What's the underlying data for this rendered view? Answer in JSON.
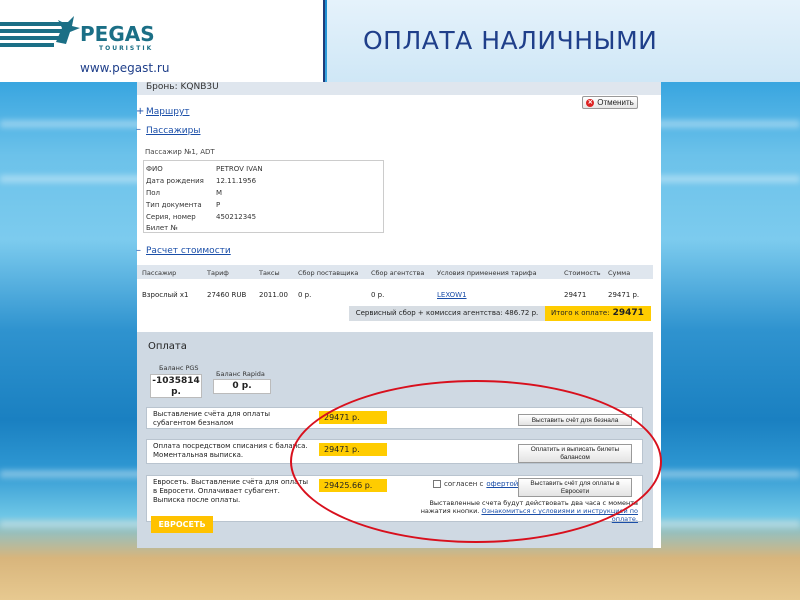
{
  "header": {
    "brand": "PEGAS",
    "brand_sub": "TOURISTIK",
    "url": "www.pegast.ru",
    "slide_title": "ОПЛАТА НАЛИЧНЫМИ"
  },
  "booking": {
    "label": "Бронь: KQNB3U",
    "cancel_label": "Отменить"
  },
  "sections": {
    "route": "Маршрут",
    "route_prefix": "+",
    "passengers": "Пассажиры",
    "passengers_prefix": "–",
    "pricing": "Расчет стоимости",
    "pricing_prefix": "–"
  },
  "passenger": {
    "title": "Пассажир №1, ADT",
    "rows": [
      {
        "label": "ФИО",
        "value": "PETROV IVAN"
      },
      {
        "label": "Дата рождения",
        "value": "12.11.1956"
      },
      {
        "label": "Пол",
        "value": "M"
      },
      {
        "label": "Тип документа",
        "value": "P"
      },
      {
        "label": "Серия, номер",
        "value": "450212345"
      },
      {
        "label": "Билет №",
        "value": ""
      }
    ]
  },
  "pricing_table": {
    "headers": [
      "Пассажир",
      "Тариф",
      "Таксы",
      "Сбор поставщика",
      "Сбор агентства",
      "Условия применения тарифа",
      "Стоимость",
      "Сумма"
    ],
    "row": [
      "Взрослый x1",
      "27460 RUB",
      "2011.00",
      "0 р.",
      "0 р.",
      "LEXOW1",
      "29471",
      "29471 р."
    ],
    "service_fee": "Сервисный сбор + комиссия агентства: 486.72 р.",
    "total_label": "Итого к оплате:",
    "total_value": "29471"
  },
  "payment": {
    "title": "Оплата",
    "balance_pgs_label": "Баланс PGS",
    "balance_pgs_value": "-1035814 р.",
    "balance_rapida_label": "Баланс Rapida",
    "balance_rapida_value": "0 р.",
    "options": [
      {
        "text": "Выставление счёта для оплаты субагентом безналом",
        "amount": "29471 р.",
        "button": "Выставить счёт для безнала"
      },
      {
        "text": "Оплата посредством списания с баланса. Моментальная выписка.",
        "amount": "29471 р.",
        "button": "Оплатить и выписать билеты балансом"
      },
      {
        "text": "Евросеть. Выставление счёта для оплаты в Евросети. Оплачивает субагент. Выписка после оплаты.",
        "amount": "29425.66 р.",
        "button": "Выставить счёт для оплаты в Евросети"
      }
    ],
    "agree_prefix": "согласен с",
    "agree_link": "офертой",
    "note_text": "Выставленные счета будут действовать два часа с момента нажатия кнопки.",
    "note_link": "Ознакомиться с условиями и инструкцией по оплате.",
    "euroset_logo": "ЕВРОСЕТЬ"
  },
  "colors": {
    "accent_yellow": "#ffcc00",
    "title_blue": "#1f3f8a",
    "annotation_red": "#d8101d"
  }
}
